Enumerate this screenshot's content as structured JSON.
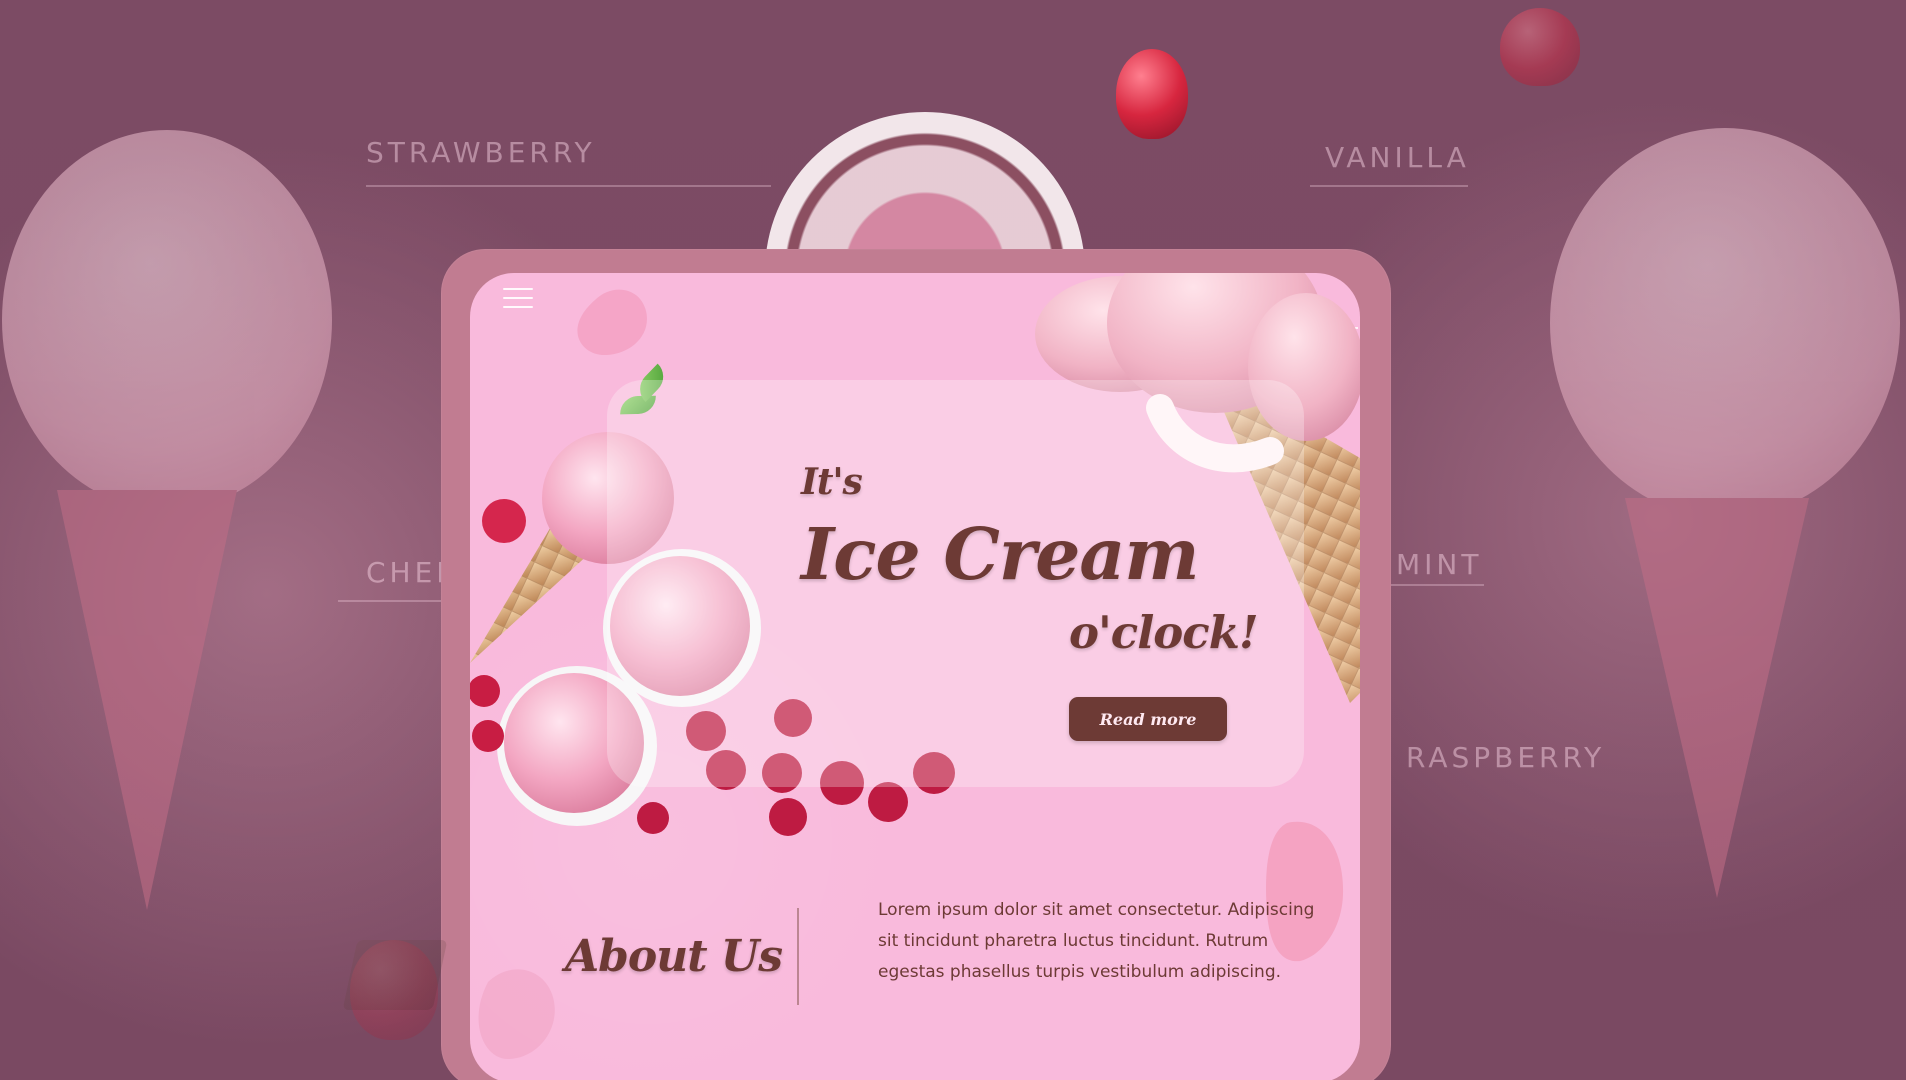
{
  "background": {
    "flavors": [
      "STRAWBERRY",
      "VANILLA",
      "CHER",
      "MINT",
      "RASPBERRY"
    ]
  },
  "hero": {
    "kicker": "It's",
    "title": "Ice Cream",
    "subtitle": "o'clock!",
    "button_label": "Read more"
  },
  "about": {
    "title": "About Us",
    "copy": "Lorem ipsum dolor sit amet consectetur. Adipiscing sit tincidunt pharetra luctus tincidunt. Rutrum egestas phasellus turpis vestibulum adipiscing."
  },
  "icons": {
    "menu": "menu-icon"
  },
  "colors": {
    "page_bg": "#7a4c64",
    "device_frame": "#c17c91",
    "screen_bg": "#f9badc",
    "heading": "#6d3a35",
    "button_bg": "#6d3a35"
  }
}
